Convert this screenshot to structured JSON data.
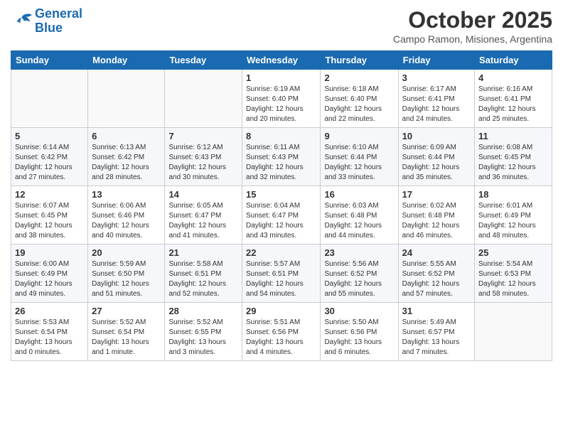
{
  "header": {
    "logo_line1": "General",
    "logo_line2": "Blue",
    "month": "October 2025",
    "location": "Campo Ramon, Misiones, Argentina"
  },
  "weekdays": [
    "Sunday",
    "Monday",
    "Tuesday",
    "Wednesday",
    "Thursday",
    "Friday",
    "Saturday"
  ],
  "weeks": [
    [
      {
        "day": "",
        "info": ""
      },
      {
        "day": "",
        "info": ""
      },
      {
        "day": "",
        "info": ""
      },
      {
        "day": "1",
        "info": "Sunrise: 6:19 AM\nSunset: 6:40 PM\nDaylight: 12 hours\nand 20 minutes."
      },
      {
        "day": "2",
        "info": "Sunrise: 6:18 AM\nSunset: 6:40 PM\nDaylight: 12 hours\nand 22 minutes."
      },
      {
        "day": "3",
        "info": "Sunrise: 6:17 AM\nSunset: 6:41 PM\nDaylight: 12 hours\nand 24 minutes."
      },
      {
        "day": "4",
        "info": "Sunrise: 6:16 AM\nSunset: 6:41 PM\nDaylight: 12 hours\nand 25 minutes."
      }
    ],
    [
      {
        "day": "5",
        "info": "Sunrise: 6:14 AM\nSunset: 6:42 PM\nDaylight: 12 hours\nand 27 minutes."
      },
      {
        "day": "6",
        "info": "Sunrise: 6:13 AM\nSunset: 6:42 PM\nDaylight: 12 hours\nand 28 minutes."
      },
      {
        "day": "7",
        "info": "Sunrise: 6:12 AM\nSunset: 6:43 PM\nDaylight: 12 hours\nand 30 minutes."
      },
      {
        "day": "8",
        "info": "Sunrise: 6:11 AM\nSunset: 6:43 PM\nDaylight: 12 hours\nand 32 minutes."
      },
      {
        "day": "9",
        "info": "Sunrise: 6:10 AM\nSunset: 6:44 PM\nDaylight: 12 hours\nand 33 minutes."
      },
      {
        "day": "10",
        "info": "Sunrise: 6:09 AM\nSunset: 6:44 PM\nDaylight: 12 hours\nand 35 minutes."
      },
      {
        "day": "11",
        "info": "Sunrise: 6:08 AM\nSunset: 6:45 PM\nDaylight: 12 hours\nand 36 minutes."
      }
    ],
    [
      {
        "day": "12",
        "info": "Sunrise: 6:07 AM\nSunset: 6:45 PM\nDaylight: 12 hours\nand 38 minutes."
      },
      {
        "day": "13",
        "info": "Sunrise: 6:06 AM\nSunset: 6:46 PM\nDaylight: 12 hours\nand 40 minutes."
      },
      {
        "day": "14",
        "info": "Sunrise: 6:05 AM\nSunset: 6:47 PM\nDaylight: 12 hours\nand 41 minutes."
      },
      {
        "day": "15",
        "info": "Sunrise: 6:04 AM\nSunset: 6:47 PM\nDaylight: 12 hours\nand 43 minutes."
      },
      {
        "day": "16",
        "info": "Sunrise: 6:03 AM\nSunset: 6:48 PM\nDaylight: 12 hours\nand 44 minutes."
      },
      {
        "day": "17",
        "info": "Sunrise: 6:02 AM\nSunset: 6:48 PM\nDaylight: 12 hours\nand 46 minutes."
      },
      {
        "day": "18",
        "info": "Sunrise: 6:01 AM\nSunset: 6:49 PM\nDaylight: 12 hours\nand 48 minutes."
      }
    ],
    [
      {
        "day": "19",
        "info": "Sunrise: 6:00 AM\nSunset: 6:49 PM\nDaylight: 12 hours\nand 49 minutes."
      },
      {
        "day": "20",
        "info": "Sunrise: 5:59 AM\nSunset: 6:50 PM\nDaylight: 12 hours\nand 51 minutes."
      },
      {
        "day": "21",
        "info": "Sunrise: 5:58 AM\nSunset: 6:51 PM\nDaylight: 12 hours\nand 52 minutes."
      },
      {
        "day": "22",
        "info": "Sunrise: 5:57 AM\nSunset: 6:51 PM\nDaylight: 12 hours\nand 54 minutes."
      },
      {
        "day": "23",
        "info": "Sunrise: 5:56 AM\nSunset: 6:52 PM\nDaylight: 12 hours\nand 55 minutes."
      },
      {
        "day": "24",
        "info": "Sunrise: 5:55 AM\nSunset: 6:52 PM\nDaylight: 12 hours\nand 57 minutes."
      },
      {
        "day": "25",
        "info": "Sunrise: 5:54 AM\nSunset: 6:53 PM\nDaylight: 12 hours\nand 58 minutes."
      }
    ],
    [
      {
        "day": "26",
        "info": "Sunrise: 5:53 AM\nSunset: 6:54 PM\nDaylight: 13 hours\nand 0 minutes."
      },
      {
        "day": "27",
        "info": "Sunrise: 5:52 AM\nSunset: 6:54 PM\nDaylight: 13 hours\nand 1 minute."
      },
      {
        "day": "28",
        "info": "Sunrise: 5:52 AM\nSunset: 6:55 PM\nDaylight: 13 hours\nand 3 minutes."
      },
      {
        "day": "29",
        "info": "Sunrise: 5:51 AM\nSunset: 6:56 PM\nDaylight: 13 hours\nand 4 minutes."
      },
      {
        "day": "30",
        "info": "Sunrise: 5:50 AM\nSunset: 6:56 PM\nDaylight: 13 hours\nand 6 minutes."
      },
      {
        "day": "31",
        "info": "Sunrise: 5:49 AM\nSunset: 6:57 PM\nDaylight: 13 hours\nand 7 minutes."
      },
      {
        "day": "",
        "info": ""
      }
    ]
  ]
}
